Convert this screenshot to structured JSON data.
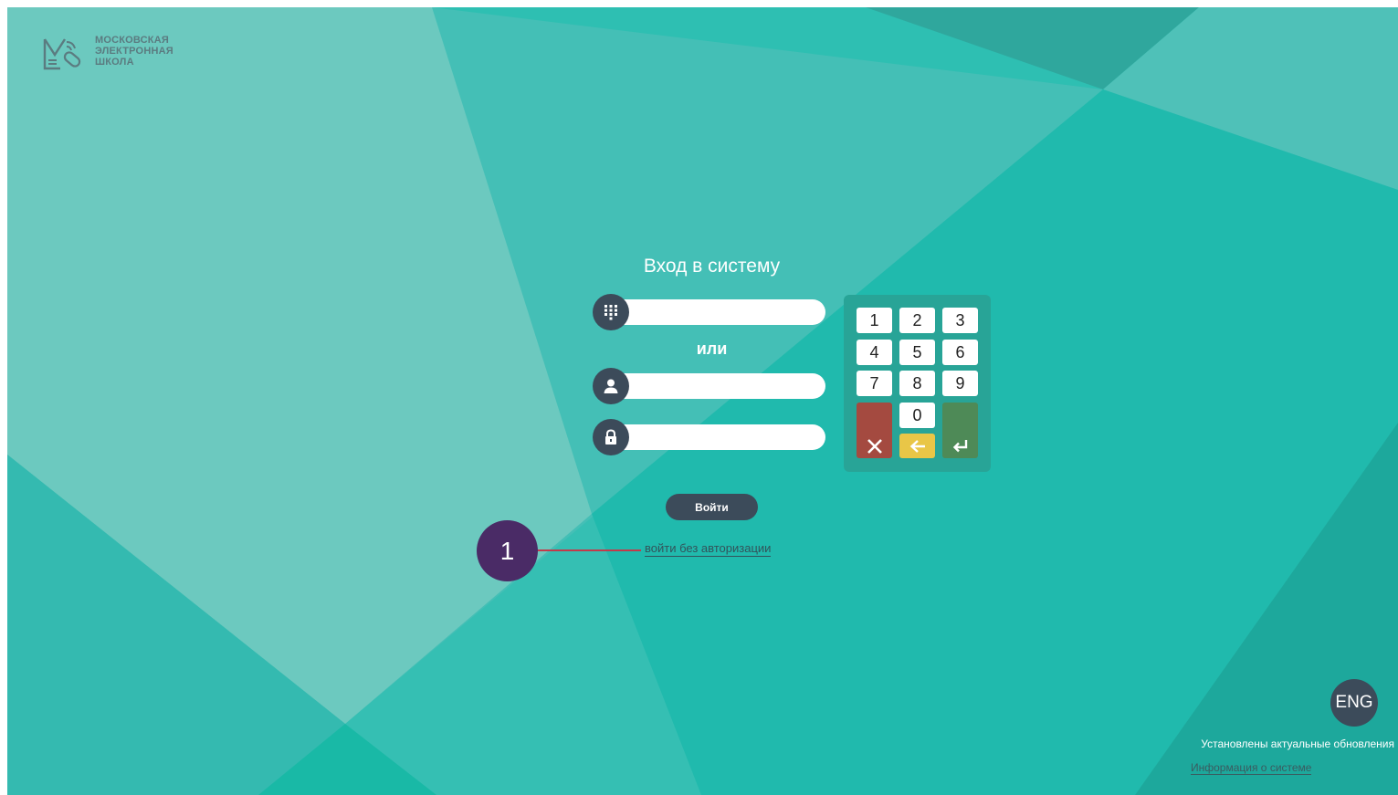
{
  "logo": {
    "line1": "МОСКОВСКАЯ",
    "line2": "ЭЛЕКТРОННАЯ",
    "line3": "ШКОЛА"
  },
  "login": {
    "title": "Вход в систему",
    "or_label": "или",
    "submit_label": "Войти",
    "no_auth_link": "войти без авторизации"
  },
  "keypad": {
    "keys": [
      "1",
      "2",
      "3",
      "4",
      "5",
      "6",
      "7",
      "8",
      "9",
      "0"
    ]
  },
  "callout": {
    "number": "1"
  },
  "footer": {
    "language_button": "ENG",
    "status": "Установлены актуальные обновления",
    "system_info_link": "Информация о системе"
  },
  "colors": {
    "background": "#2ebfb2",
    "dark_accent": "#3c4b5a",
    "callout": "#4a2b66",
    "callout_line": "#c33a4a",
    "clear_key": "#a44a40",
    "back_key": "#e9c647",
    "enter_key": "#4e8a57"
  }
}
